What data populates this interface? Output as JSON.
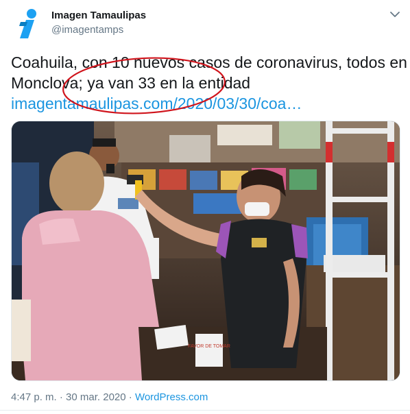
{
  "user": {
    "display_name": "Imagen Tamaulipas",
    "handle": "@imagentamps",
    "avatar_icon": "imagen-tamaulipas-logo-icon"
  },
  "tweet": {
    "text_line1": "Coahuila, con 10 nuevos casos de coronavirus, todos en",
    "text_line2": "Monclova; ya van 33 en la entidad",
    "link": "imagentamaulipas.com/2020/03/30/coa…"
  },
  "media": {
    "signs": [
      "FAVOR DE TOMAR"
    ]
  },
  "meta": {
    "time": "4:47 p. m.",
    "separator": "·",
    "date": "30 mar. 2020",
    "source": "WordPress.com"
  },
  "colors": {
    "link": "#1b95e0",
    "secondary_text": "#657786",
    "annotation_circle": "#d0141c",
    "avatar_blue": "#1da1f2"
  }
}
